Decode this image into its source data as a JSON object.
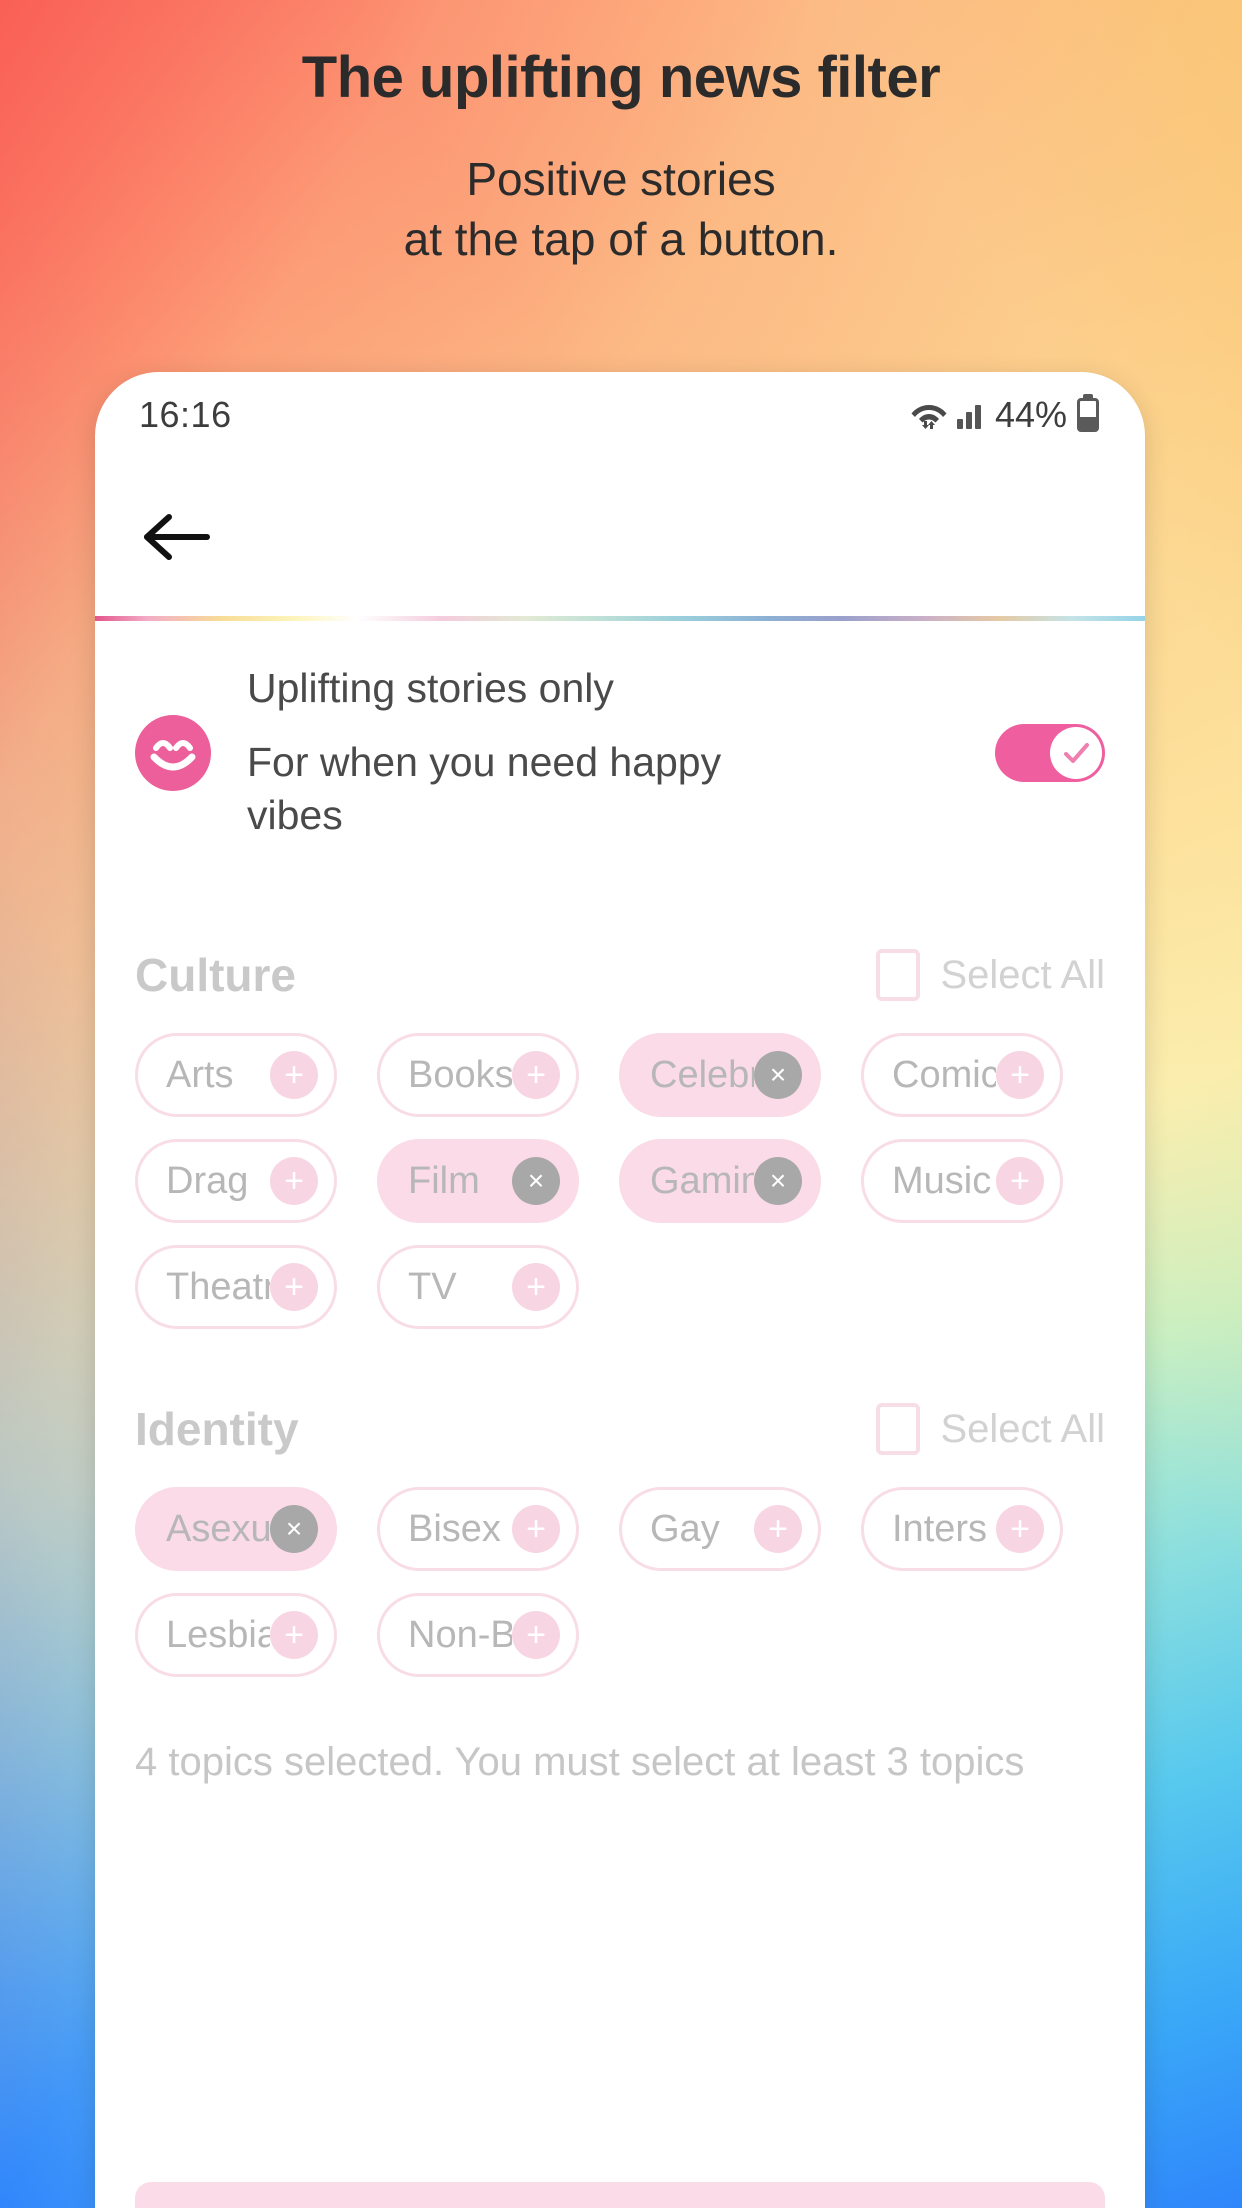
{
  "promo": {
    "headline": "The uplifting news filter",
    "subline_1": "Positive stories",
    "subline_2": "at the tap of a button."
  },
  "phone": {
    "statusbar": {
      "time": "16:16",
      "battery_percent": "44%",
      "wifi_icon": "wifi-icon",
      "signal_icon": "cellular-signal-icon",
      "battery_icon": "battery-icon"
    },
    "appbar": {
      "back_icon": "back-arrow-icon"
    },
    "uplift": {
      "icon": "smiley-face-icon",
      "title": "Uplifting stories only",
      "subtitle": "For when you need happy vibes",
      "toggle_on": true,
      "toggle_icon": "check-icon",
      "accent_color": "#ef5fa0"
    },
    "sections": [
      {
        "title": "Culture",
        "select_all_label": "Select All",
        "select_all_checked": false,
        "chips": [
          {
            "label": "Arts",
            "selected": false,
            "action": "+"
          },
          {
            "label": "Books",
            "selected": false,
            "action": "+"
          },
          {
            "label": "Celebr",
            "selected": true,
            "action": "×"
          },
          {
            "label": "Comic",
            "selected": false,
            "action": "+"
          },
          {
            "label": "Drag",
            "selected": false,
            "action": "+"
          },
          {
            "label": "Film",
            "selected": true,
            "action": "×"
          },
          {
            "label": "Gamin",
            "selected": true,
            "action": "×"
          },
          {
            "label": "Music",
            "selected": false,
            "action": "+"
          },
          {
            "label": "Theatr",
            "selected": false,
            "action": "+"
          },
          {
            "label": "TV",
            "selected": false,
            "action": "+"
          }
        ]
      },
      {
        "title": "Identity",
        "select_all_label": "Select All",
        "select_all_checked": false,
        "chips": [
          {
            "label": "Asexu",
            "selected": true,
            "action": "×"
          },
          {
            "label": "Bisex",
            "selected": false,
            "action": "+"
          },
          {
            "label": "Gay",
            "selected": false,
            "action": "+"
          },
          {
            "label": "Inters",
            "selected": false,
            "action": "+"
          },
          {
            "label": "Lesbia",
            "selected": false,
            "action": "+"
          },
          {
            "label": "Non-Bi",
            "selected": false,
            "action": "+"
          }
        ]
      }
    ],
    "note": "4 topics selected. You must select at least 3 topics"
  },
  "colors": {
    "chip_selected_bg": "#fbdbe7",
    "chip_border": "#f8dde7",
    "accent_pink": "#ef5fa0",
    "muted_text": "#c6c6c6"
  }
}
